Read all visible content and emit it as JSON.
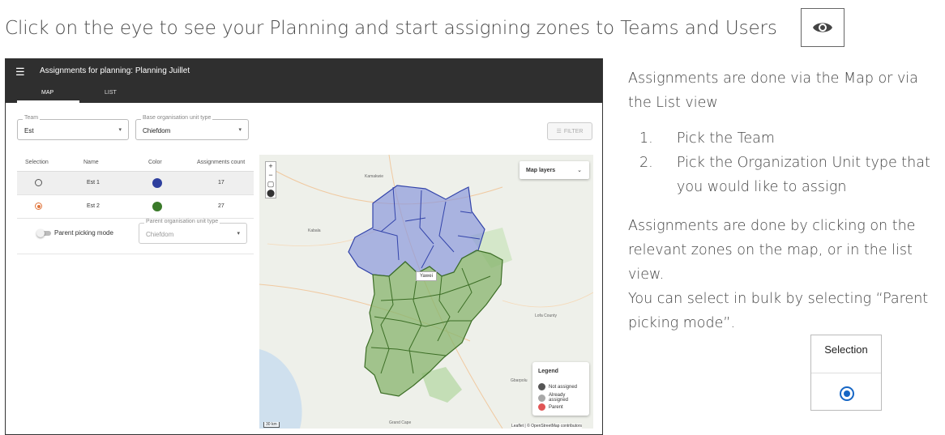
{
  "headline": "Click on the eye to see your Planning and start assigning zones to Teams and Users",
  "app": {
    "title": "Assignments for planning: Planning Juillet",
    "tabs": [
      "MAP",
      "LIST"
    ],
    "team_field": {
      "label": "Team",
      "value": "Est"
    },
    "org_type_field": {
      "label": "Base organisation unit type",
      "value": "Chiefdom"
    },
    "filter_label": "FILTER",
    "table": {
      "headers": [
        "Selection",
        "Name",
        "Color",
        "Assignments count"
      ],
      "rows": [
        {
          "name": "Est 1",
          "color": "#2e3f9e",
          "count": "17",
          "selected": false
        },
        {
          "name": "Est 2",
          "color": "#3a7a2a",
          "count": "27",
          "selected": true
        }
      ]
    },
    "parent_mode_label": "Parent picking mode",
    "parent_org_field": {
      "label": "Parent organisation unit type",
      "value": "Chiefdom"
    },
    "map": {
      "layers_label": "Map layers",
      "tooltip": "Yawei",
      "scale": "30 km",
      "attribution": "Leaflet | © OpenStreetMap contributors",
      "legend": {
        "title": "Legend",
        "items": [
          {
            "label": "Not assigned",
            "color": "#555555"
          },
          {
            "label": "Already assigned",
            "color": "#a8a8a8"
          },
          {
            "label": "Parent",
            "color": "#e05555"
          }
        ]
      }
    }
  },
  "right": {
    "para1": "Assignments are done via the Map or via the List view",
    "steps": [
      "Pick the Team",
      "Pick the Organization Unit type that you would like to assign"
    ],
    "para2a": "Assignments are done by clicking on the relevant zones on the map, or in the list view.",
    "para2b": "You can select in bulk by selecting “Parent picking mode”.",
    "selection_header": "Selection"
  }
}
